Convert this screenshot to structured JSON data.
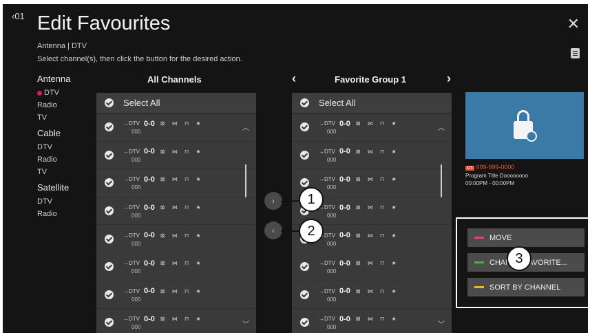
{
  "header": {
    "back_number": "‹01",
    "title": "Edit Favourites",
    "subtitle": "Antenna | DTV",
    "instruction": "Select channel(s), then click the button for the desired action."
  },
  "sidebar": {
    "groups": [
      {
        "label": "Antenna",
        "items": [
          {
            "label": "DTV",
            "active": true
          },
          {
            "label": "Radio"
          },
          {
            "label": "TV"
          }
        ]
      },
      {
        "label": "Cable",
        "items": [
          {
            "label": "DTV"
          },
          {
            "label": "Radio"
          },
          {
            "label": "TV"
          }
        ]
      },
      {
        "label": "Satellite",
        "items": [
          {
            "label": "DTV"
          },
          {
            "label": "Radio"
          }
        ]
      }
    ]
  },
  "left_panel": {
    "header": "All Channels",
    "select_all": "Select All",
    "channel": {
      "type": "→DTV",
      "number": "0-0",
      "icons": "⊠ ⋈ ⊓ ★",
      "name": "000"
    },
    "row_count": 8
  },
  "right_panel": {
    "header": "Favorite Group 1",
    "prev_arrow": "‹",
    "next_arrow": "›",
    "select_all": "Select All",
    "channel": {
      "type": "→DTV",
      "number": "0-0",
      "icons": "⊠ ⋈ ⊓ ★",
      "name": "000"
    },
    "row_count": 8
  },
  "middle": {
    "add_arrow": "›",
    "remove_arrow": "‹"
  },
  "preview": {
    "badge": "DT",
    "channel": "999-999-0000",
    "program_title": "Program Title Doooooooo",
    "program_time": "00:00PM - 00:00PM"
  },
  "actions": [
    {
      "label": "MOVE",
      "color": "#e8475f"
    },
    {
      "label": "CHANGE FAVORITE...",
      "color": "#46b549"
    },
    {
      "label": "SORT BY CHANNEL",
      "color": "#e8b830"
    }
  ],
  "callouts": [
    "1",
    "2",
    "3"
  ],
  "colors": {
    "accent_red": "#d6204a",
    "program_orange": "#e6582a",
    "preview_blue": "#3b79a7"
  }
}
